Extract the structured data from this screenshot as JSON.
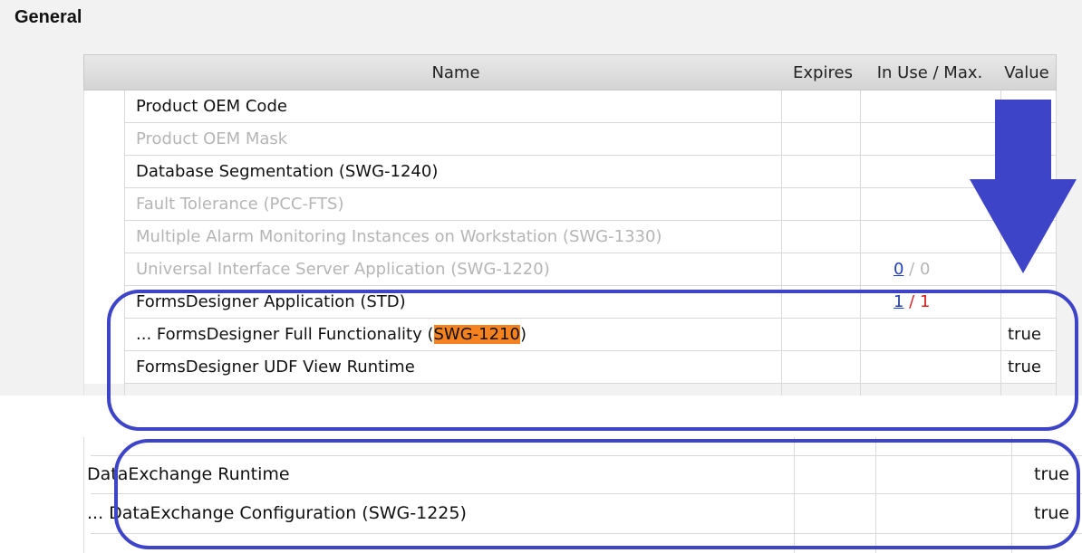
{
  "section": {
    "title": "General"
  },
  "table": {
    "columns": {
      "name": "Name",
      "expires": "Expires",
      "in_use": "In Use / Max.",
      "value": "Value"
    },
    "rows": [
      {
        "name": "Product OEM Code",
        "enabled": true,
        "value": ""
      },
      {
        "name": "Product OEM Mask",
        "enabled": false,
        "value": ""
      },
      {
        "name": "Database Segmentation (SWG-1240)",
        "enabled": true,
        "value": ""
      },
      {
        "name": "Fault Tolerance (PCC-FTS)",
        "enabled": false,
        "value": ""
      },
      {
        "name": "Multiple Alarm Monitoring Instances on Workstation (SWG-1330)",
        "enabled": false,
        "value": ""
      },
      {
        "name": "Universal Interface Server Application (SWG-1220)",
        "enabled": false,
        "in_use": "0",
        "max": "0",
        "value": ""
      },
      {
        "name": "FormsDesigner Application (STD)",
        "enabled": true,
        "in_use": "1",
        "max": "1",
        "value": ""
      },
      {
        "name_prefix": "... FormsDesigner Full Functionality (",
        "name_highlight": "SWG-1210",
        "name_suffix": ")",
        "enabled": true,
        "value": "true"
      },
      {
        "name": "FormsDesigner UDF View Runtime",
        "enabled": true,
        "value": "true"
      }
    ]
  },
  "bottom_table": {
    "rows": [
      {
        "name": "DataExchange Runtime",
        "value": "true"
      },
      {
        "name": "... DataExchange Configuration (SWG-1225)",
        "value": "true"
      }
    ]
  },
  "colors": {
    "annotation": "#3d44c8",
    "highlight": "#f5821f",
    "link": "#1f3fbf",
    "max_exceeded": "#d82020"
  },
  "icons": {
    "annotation_arrow": "arrow-down-icon"
  }
}
